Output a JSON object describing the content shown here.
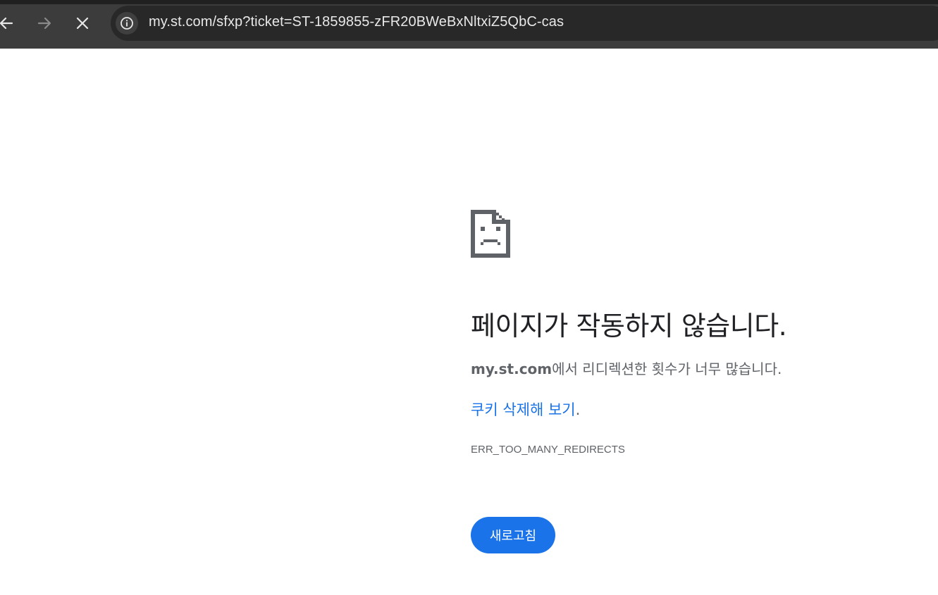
{
  "browser": {
    "url": "my.st.com/sfxp?ticket=ST-1859855-zFR20BWeBxNltxiZ5QbC-cas",
    "back_icon": "arrow-left-icon",
    "forward_icon": "arrow-right-icon",
    "stop_icon": "close-icon",
    "site_info_icon": "info-icon",
    "colors": {
      "toolbar": "#3c3c3c",
      "omnibox": "#282828",
      "url_text": "#e8e8e8"
    }
  },
  "error_page": {
    "icon": "sad-page-icon",
    "headline": "페이지가 작동하지 않습니다.",
    "detail_host": "my.st.com",
    "detail_text": "에서 리디렉션한 횟수가 너무 많습니다.",
    "suggestion_link": "쿠키 삭제해 보기",
    "suggestion_period": ".",
    "error_code": "ERR_TOO_MANY_REDIRECTS",
    "reload_label": "새로고침",
    "colors": {
      "accent": "#1a73e8",
      "headline": "#202124",
      "body_text": "#5f6368"
    }
  }
}
